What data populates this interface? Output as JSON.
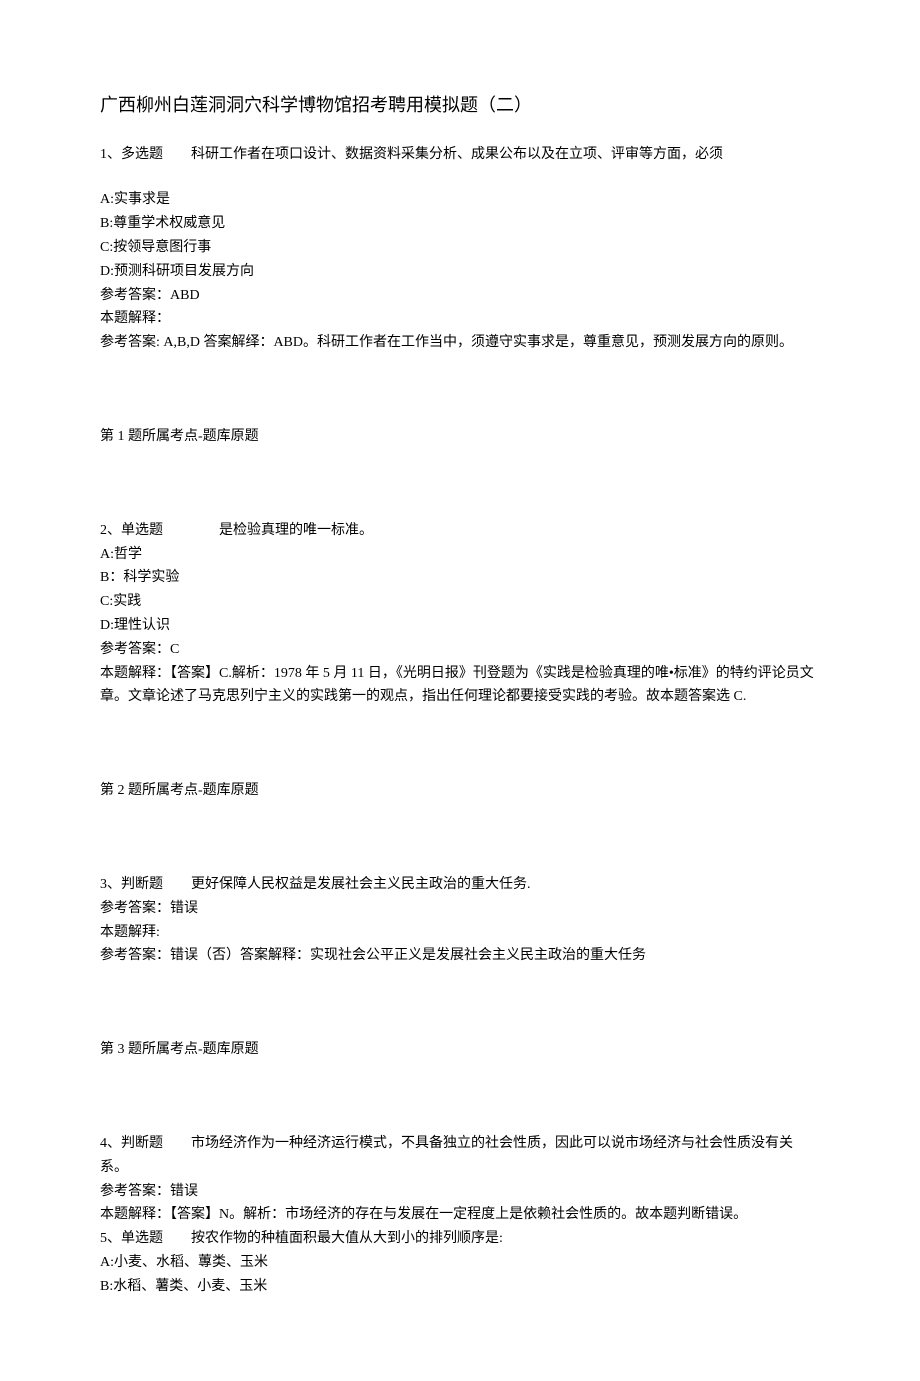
{
  "title": "广西柳州白莲洞洞穴科学博物馆招考聘用模拟题（二）",
  "q1": {
    "header": "1、多选题　　科研工作者在项口设计、数据资料采集分析、成果公布以及在立项、评审等方面，必须",
    "a": "A:实事求是",
    "b": "B:尊重学术权威意见",
    "c": "C:按领导意图行事",
    "d": "D:预测科研项目发展方向",
    "ans": "参考答案：ABD",
    "exp1": "本题解释：",
    "exp2": "参考答案: A,B,D 答案解绎：ABD。科研工作者在工作当中，须遵守实事求是，尊重意见，预测发展方向的原则。",
    "foot": "第 1 题所属考点-题库原题"
  },
  "q2": {
    "header": "2、单选题　　　　是检验真理的唯一标准。",
    "a": "A:哲学",
    "b": "B：科学实验",
    "c": "C:实践",
    "d": "D:理性认识",
    "ans": "参考答案：C",
    "exp": "本题解释：【答案】C.解析：1978 年 5 月 11 日，《光明日报》刊登题为《实践是检验真理的唯•标准》的特约评论员文章。文章论述了马克思列宁主义的实践第一的观点，指出任何理论都要接受实践的考验。故本题答案选 C.",
    "foot": "第 2 题所属考点-题库原题"
  },
  "q3": {
    "header": "3、判断题　　更好保障人民权益是发展社会主义民主政治的重大任务.",
    "ans": "参考答案：错误",
    "exp1": "本题解拜:",
    "exp2": "参考答案：错误（否）答案解释：实现社会公平正义是发展社会主义民主政治的重大任务",
    "foot": "第 3 题所属考点-题库原题"
  },
  "q4": {
    "header": "4、判断题　　市场经济作为一种经济运行模式，不具备独立的社会性质，因此可以说市场经济与社会性质没有关系。",
    "ans": "参考答案：错误",
    "exp": "本题解释：【答案】N。解析：市场经济的存在与发展在一定程度上是依赖社会性质的。故本题判断错误。"
  },
  "q5": {
    "header": "5、单选题　　按农作物的种植面积最大值从大到小的排列顺序是:",
    "a": "A:小麦、水稻、蓴类、玉米",
    "b": "B:水稻、薯类、小麦、玉米"
  }
}
